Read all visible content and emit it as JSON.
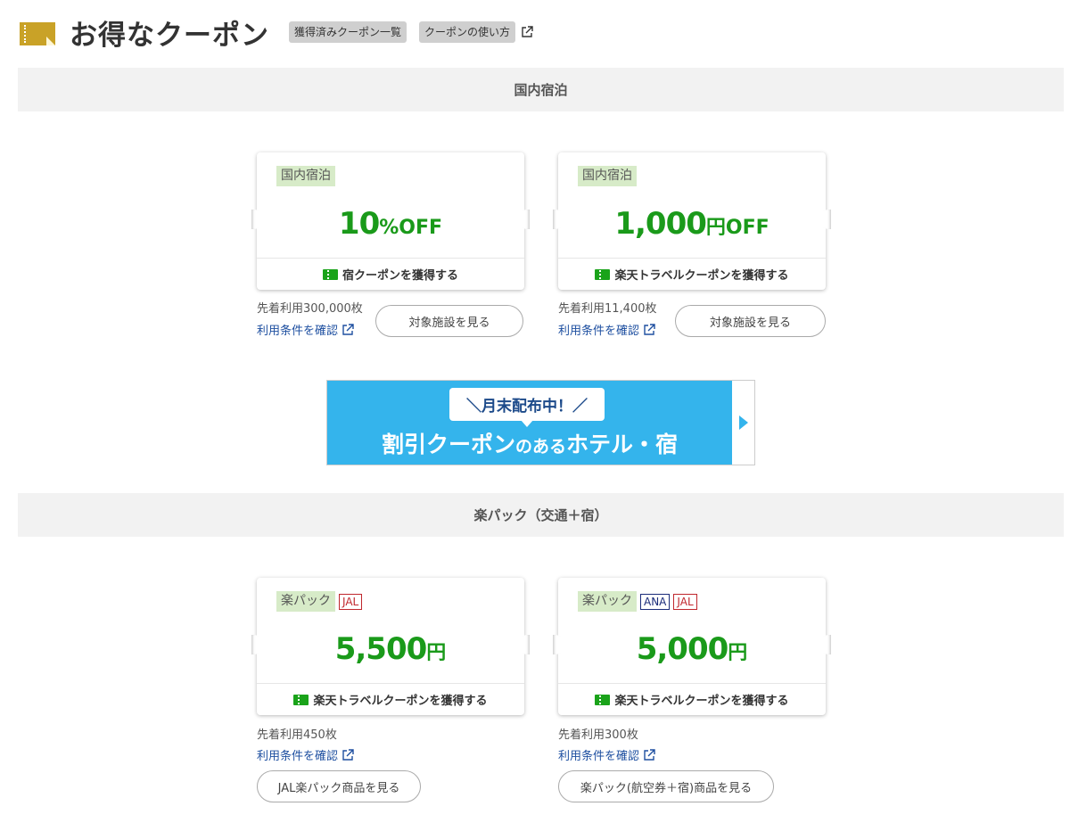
{
  "header": {
    "title": "お得なクーポン",
    "acquired_link": "獲得済みクーポン一覧",
    "howto_link": "クーポンの使い方"
  },
  "sections": [
    {
      "title": "国内宿泊",
      "coupons": [
        {
          "category": "国内宿泊",
          "airlines": [],
          "amount": "10",
          "unit": "%OFF",
          "action": "宿クーポンを獲得する",
          "first_come": "先着利用300,000枚",
          "terms": "利用条件を確認",
          "view_button": "対象施設を見る"
        },
        {
          "category": "国内宿泊",
          "airlines": [],
          "amount": "1,000",
          "unit": "円OFF",
          "action": "楽天トラベルクーポンを獲得する",
          "first_come": "先着利用11,400枚",
          "terms": "利用条件を確認",
          "view_button": "対象施設を見る"
        }
      ]
    },
    {
      "title": "楽パック（交通＋宿）",
      "coupons": [
        {
          "category": "楽パック",
          "airlines": [
            "JAL"
          ],
          "amount": "5,500",
          "unit": "円",
          "action": "楽天トラベルクーポンを獲得する",
          "first_come": "先着利用450枚",
          "terms": "利用条件を確認",
          "view_button": "JAL楽パック商品を見る"
        },
        {
          "category": "楽パック",
          "airlines": [
            "ANA",
            "JAL"
          ],
          "amount": "5,000",
          "unit": "円",
          "action": "楽天トラベルクーポンを獲得する",
          "first_come": "先着利用300枚",
          "terms": "利用条件を確認",
          "view_button": "楽パック(航空券＋宿)商品を見る"
        }
      ]
    }
  ],
  "banner": {
    "bubble": "＼月末配布中！／",
    "main_1": "割引クーポン",
    "main_2": "のある",
    "main_3": "ホテル・宿"
  },
  "colors": {
    "accent_green": "#1a9a1a",
    "banner_blue": "#34b4ec",
    "title_icon": "#c9a227",
    "link_blue": "#1e4fa0"
  }
}
